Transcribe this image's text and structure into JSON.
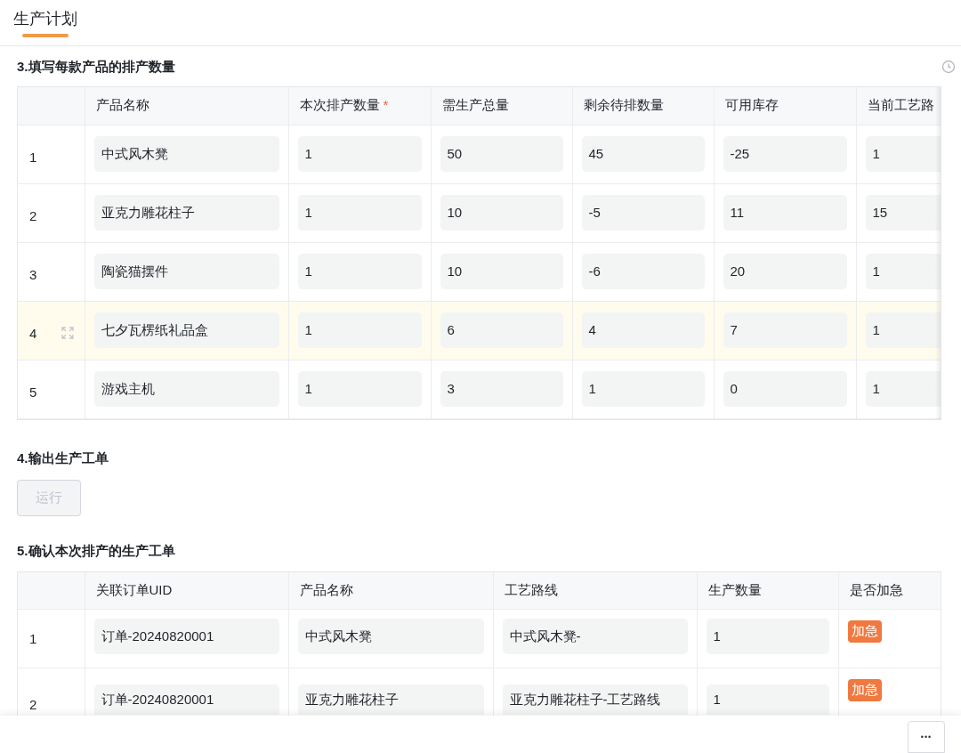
{
  "tabs": [
    {
      "label": "生产计划",
      "selected": true
    }
  ],
  "section_fill": {
    "title": "3.填写每款产品的排产数量",
    "required_mark": "*",
    "columns": [
      {
        "label": "产品名称",
        "required": false
      },
      {
        "label": "本次排产数量",
        "required": true
      },
      {
        "label": "需生产总量",
        "required": false
      },
      {
        "label": "剩余待排数量",
        "required": false
      },
      {
        "label": "可用库存",
        "required": false
      },
      {
        "label": "当前工艺路",
        "required": false
      }
    ],
    "rows": [
      {
        "index": "1",
        "highlighted": false,
        "cells": [
          "中式风木凳",
          "1",
          "50",
          "45",
          "-25",
          "1"
        ]
      },
      {
        "index": "2",
        "highlighted": false,
        "cells": [
          "亚克力雕花柱子",
          "1",
          "10",
          "-5",
          "11",
          "15"
        ]
      },
      {
        "index": "3",
        "highlighted": false,
        "cells": [
          "陶瓷猫摆件",
          "1",
          "10",
          "-6",
          "20",
          "1"
        ]
      },
      {
        "index": "4",
        "highlighted": true,
        "cells": [
          "七夕瓦楞纸礼品盒",
          "1",
          "6",
          "4",
          "7",
          "1"
        ]
      },
      {
        "index": "5",
        "highlighted": false,
        "cells": [
          "游戏主机",
          "1",
          "3",
          "1",
          "0",
          "1"
        ]
      }
    ]
  },
  "section_output": {
    "title": "4.输出生产工单",
    "button": {
      "label": "运行",
      "disabled": true
    }
  },
  "section_confirm": {
    "title": "5.确认本次排产的生产工单",
    "columns": [
      "关联订单UID",
      "产品名称",
      "工艺路线",
      "生产数量",
      "是否加急"
    ],
    "rows": [
      {
        "index": "1",
        "cells": [
          "订单-20240820001",
          "中式风木凳",
          "中式风木凳-",
          "1"
        ],
        "urgent": "加急"
      },
      {
        "index": "2",
        "cells": [
          "订单-20240820001",
          "亚克力雕花柱子",
          "亚克力雕花柱子-工艺路线",
          "1"
        ],
        "urgent": "加急"
      }
    ]
  },
  "footer": {
    "more_button": "•••"
  }
}
